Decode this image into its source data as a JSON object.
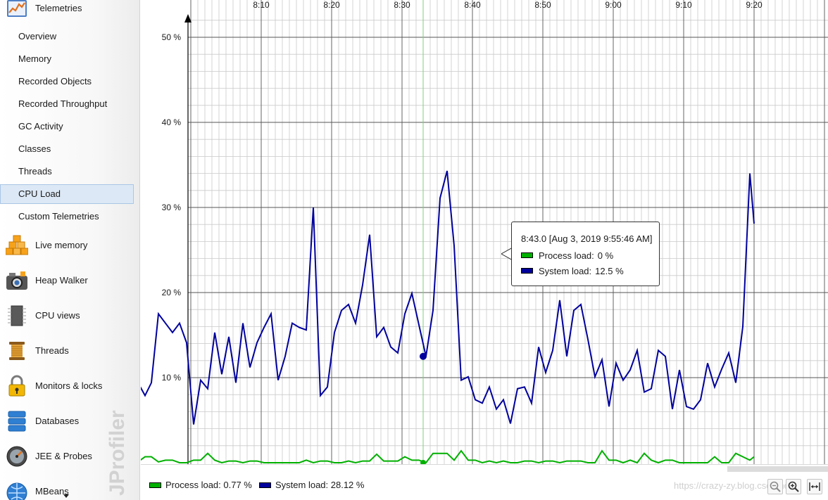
{
  "sidebar": {
    "header": {
      "label": "Telemetries",
      "icon": "telemetries-icon"
    },
    "telemetry_items": [
      {
        "label": "Overview",
        "selected": false
      },
      {
        "label": "Memory",
        "selected": false
      },
      {
        "label": "Recorded Objects",
        "selected": false
      },
      {
        "label": "Recorded Throughput",
        "selected": false
      },
      {
        "label": "GC Activity",
        "selected": false
      },
      {
        "label": "Classes",
        "selected": false
      },
      {
        "label": "Threads",
        "selected": false
      },
      {
        "label": "CPU Load",
        "selected": true
      },
      {
        "label": "Custom Telemetries",
        "selected": false
      }
    ],
    "sections": [
      {
        "label": "Live memory",
        "icon": "live-memory-icon"
      },
      {
        "label": "Heap Walker",
        "icon": "heap-walker-icon"
      },
      {
        "label": "CPU views",
        "icon": "cpu-views-icon"
      },
      {
        "label": "Threads",
        "icon": "threads-icon"
      },
      {
        "label": "Monitors & locks",
        "icon": "monitors-locks-icon"
      },
      {
        "label": "Databases",
        "icon": "databases-icon"
      },
      {
        "label": "JEE & Probes",
        "icon": "jee-probes-icon"
      },
      {
        "label": "MBeans",
        "icon": "mbeans-icon"
      }
    ],
    "watermark": "JProfiler"
  },
  "chart_data": {
    "type": "line",
    "x_ticks": [
      "8:10",
      "8:20",
      "8:30",
      "8:40",
      "8:50",
      "9:00",
      "9:10",
      "9:20"
    ],
    "x_tick_minutes": [
      10,
      20,
      30,
      40,
      50,
      60,
      70,
      80
    ],
    "y_ticks": [
      "10 %",
      "20 %",
      "30 %",
      "40 %",
      "50 %"
    ],
    "y_tick_values": [
      10,
      20,
      30,
      40,
      50
    ],
    "ylim": [
      0,
      52
    ],
    "x_minute_range": [
      1.6,
      90
    ],
    "grid": true,
    "colors": {
      "process": "#00b000",
      "system": "#00009c"
    },
    "series": [
      {
        "name": "Process load",
        "minute": [
          1.6,
          2.5,
          3.5,
          4.4,
          5.4,
          6.4,
          7.4,
          8.4,
          9.4,
          10.4,
          11.4,
          12.4,
          13.4,
          14.4,
          15.4,
          16.4,
          17.4,
          18.4,
          19.4,
          20.4,
          21.4,
          22.4,
          23.4,
          24.4,
          25.4,
          26.4,
          27.4,
          28.4,
          29.4,
          30.4,
          31.4,
          32.4,
          33.4,
          34.4,
          35.4,
          36.4,
          37.4,
          38.4,
          39.4,
          40.4,
          41.4,
          42.4,
          43.4,
          44.4,
          45.4,
          46.4,
          47.4,
          48.4,
          49.4,
          50.4,
          51.4,
          52.4,
          53.4,
          54.4,
          55.4,
          56.4,
          57.4,
          58.4,
          59.4,
          60.4,
          61.4,
          62.4,
          63.4,
          64.4,
          65.4,
          66.4,
          67.4,
          68.4,
          69.4,
          70.4,
          71.4,
          72.4,
          73.4,
          74.4,
          75.4,
          76.4,
          77.4,
          78.4,
          79.4,
          80.4,
          81.4,
          82.4,
          83.4,
          84.4,
          85.4,
          86.4,
          87.4,
          88.4,
          89.4,
          90.0
        ],
        "values": [
          0.0,
          0.1,
          0.7,
          0.7,
          0.1,
          0.3,
          0.3,
          0.0,
          0.0,
          0.3,
          0.3,
          1.1,
          0.3,
          0.0,
          0.2,
          0.2,
          0.0,
          0.2,
          0.2,
          0.0,
          0.0,
          0.0,
          0.0,
          0.0,
          0.0,
          0.3,
          0.0,
          0.2,
          0.2,
          0.0,
          0.0,
          0.2,
          0.0,
          0.2,
          0.2,
          1.0,
          0.2,
          0.2,
          0.2,
          0.7,
          0.3,
          0.3,
          0.0,
          1.1,
          1.1,
          1.1,
          0.3,
          1.4,
          0.3,
          0.3,
          0.0,
          0.2,
          0.0,
          0.2,
          0.0,
          0.0,
          0.2,
          0.2,
          0.0,
          0.2,
          0.2,
          0.0,
          0.2,
          0.2,
          0.2,
          0.0,
          0.0,
          1.4,
          0.3,
          0.3,
          0.0,
          0.3,
          0.0,
          1.1,
          0.3,
          0.0,
          0.3,
          0.3,
          0.0,
          0.0,
          0.0,
          0.0,
          0.0,
          0.7,
          0.0,
          0.0,
          1.1,
          0.7,
          0.3,
          0.7
        ]
      },
      {
        "name": "System load",
        "minute": [
          1.6,
          2.5,
          3.5,
          4.4,
          5.4,
          6.4,
          7.4,
          8.4,
          9.4,
          10.4,
          11.4,
          12.4,
          13.4,
          14.4,
          15.4,
          16.4,
          17.4,
          18.4,
          19.4,
          20.4,
          21.4,
          22.4,
          23.4,
          24.4,
          25.4,
          26.4,
          27.4,
          28.4,
          29.4,
          30.4,
          31.4,
          32.4,
          33.4,
          34.4,
          35.4,
          36.4,
          37.4,
          38.4,
          39.4,
          40.4,
          41.4,
          42.4,
          43.4,
          44.4,
          45.4,
          46.4,
          47.4,
          48.4,
          49.4,
          50.4,
          51.4,
          52.4,
          53.4,
          54.4,
          55.4,
          56.4,
          57.4,
          58.4,
          59.4,
          60.4,
          61.4,
          62.4,
          63.4,
          64.4,
          65.4,
          66.4,
          67.4,
          68.4,
          69.4,
          70.4,
          71.4,
          72.4,
          73.4,
          74.4,
          75.4,
          76.4,
          77.4,
          78.4,
          79.4,
          80.4,
          81.4,
          82.4,
          83.4,
          84.4,
          85.4,
          86.4,
          87.4,
          88.4,
          89.4,
          90.0
        ],
        "values": [
          12.0,
          9.4,
          7.9,
          9.4,
          17.5,
          16.4,
          15.3,
          16.4,
          14.1,
          4.5,
          9.7,
          8.7,
          15.3,
          10.4,
          14.8,
          9.4,
          16.4,
          11.2,
          14.1,
          15.9,
          17.5,
          9.7,
          12.5,
          16.4,
          15.9,
          15.6,
          30.0,
          7.9,
          8.9,
          15.3,
          17.9,
          18.6,
          16.4,
          20.9,
          26.8,
          14.8,
          15.9,
          13.6,
          12.9,
          17.5,
          19.9,
          16.2,
          12.5,
          17.9,
          31.1,
          34.3,
          25.5,
          9.7,
          10.1,
          7.4,
          7.0,
          8.9,
          6.3,
          7.4,
          4.6,
          8.7,
          8.9,
          7.0,
          13.6,
          10.6,
          13.2,
          19.1,
          12.5,
          17.9,
          18.6,
          14.5,
          10.1,
          12.1,
          6.6,
          11.7,
          9.7,
          10.9,
          13.2,
          8.3,
          8.7,
          13.2,
          12.5,
          6.3,
          10.9,
          6.6,
          6.3,
          7.4,
          11.7,
          8.9,
          11.0,
          12.9,
          9.4,
          16.0,
          34.0,
          28.1
        ]
      }
    ],
    "cursor_minute": 43,
    "cursor_value": 12.5
  },
  "tooltip": {
    "title": "8:43.0 [Aug 3, 2019 9:55:46 AM]",
    "rows": [
      {
        "label": "Process load:",
        "value": "0 %",
        "color": "#00b000"
      },
      {
        "label": "System load:",
        "value": "12.5 %",
        "color": "#00009c"
      }
    ]
  },
  "legend": {
    "items": [
      {
        "text": "Process load: 0.77 %",
        "color": "#00b000"
      },
      {
        "text": "System load: 28.12 %",
        "color": "#00009c"
      }
    ],
    "watermark_text": "https://crazy-zy.blog.csdn.net"
  }
}
